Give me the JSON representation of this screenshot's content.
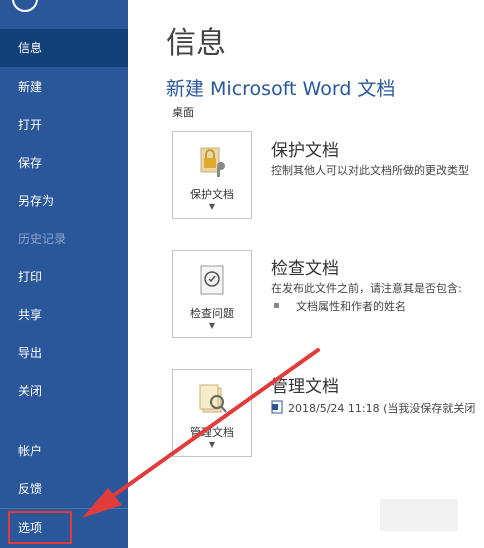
{
  "sidebar": {
    "items": [
      {
        "label": "信息"
      },
      {
        "label": "新建"
      },
      {
        "label": "打开"
      },
      {
        "label": "保存"
      },
      {
        "label": "另存为"
      },
      {
        "label": "历史记录"
      },
      {
        "label": "打印"
      },
      {
        "label": "共享"
      },
      {
        "label": "导出"
      },
      {
        "label": "关闭"
      },
      {
        "label": "帐户"
      },
      {
        "label": "反馈"
      },
      {
        "label": "选项"
      }
    ],
    "active": "信息",
    "disabled": "历史记录"
  },
  "main": {
    "title": "信息",
    "doc_name": "新建 Microsoft Word 文档",
    "location": "桌面",
    "sections": [
      {
        "tile_label": "保护文档",
        "title": "保护文档",
        "description": "控制其他人可以对此文档所做的更改类型"
      },
      {
        "tile_label": "检查问题",
        "title": "检查文档",
        "description": "在发布此文件之前，请注意其是否包含:",
        "bullet": "文档属性和作者的姓名"
      },
      {
        "tile_label": "管理文档",
        "title": "管理文档",
        "description": "2018/5/24 11:18 (当我没保存就关闭"
      }
    ]
  },
  "annotation": {
    "color": "#e23b3b"
  }
}
